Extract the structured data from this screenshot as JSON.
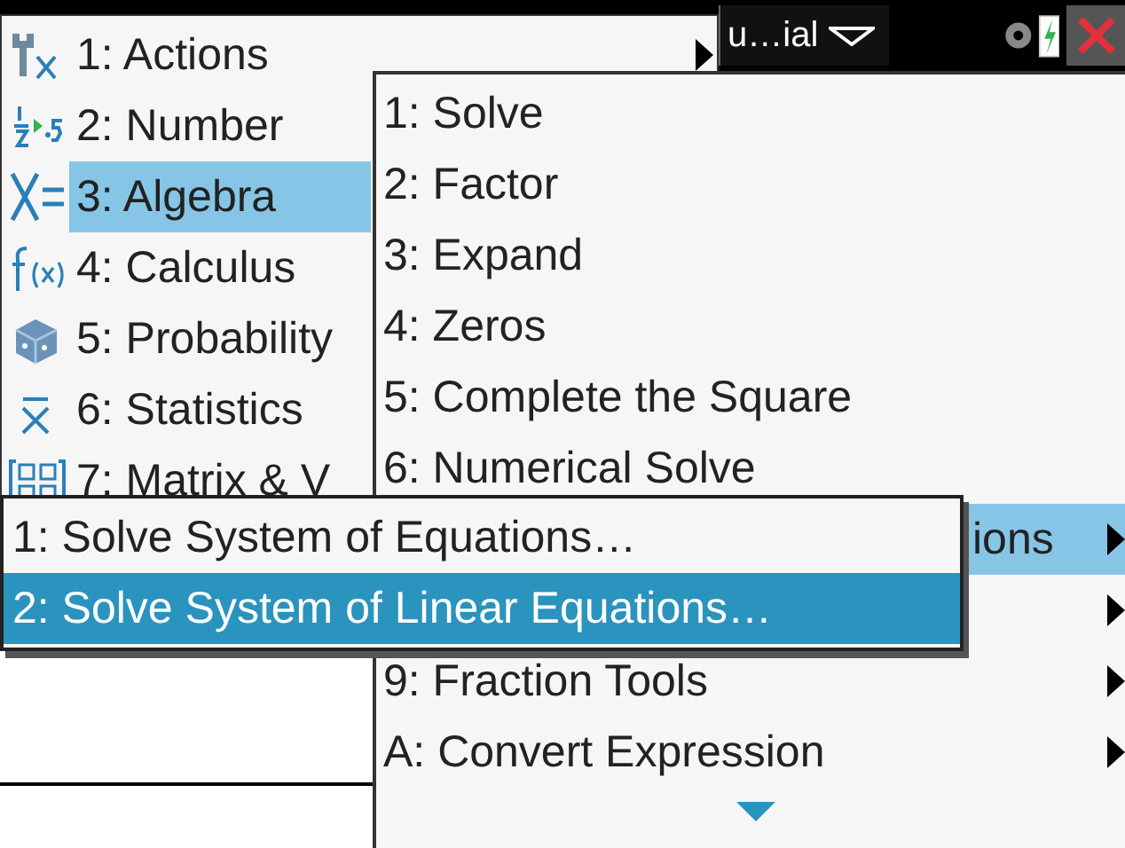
{
  "top_bar": {
    "tab_label": "u…ial"
  },
  "menu": {
    "items": [
      {
        "label": "1: Actions",
        "has_submenu": true,
        "selected": false
      },
      {
        "label": "2: Number",
        "selected": false
      },
      {
        "label": "3: Algebra",
        "selected": true
      },
      {
        "label": "4: Calculus",
        "selected": false
      },
      {
        "label": "5: Probability",
        "selected": false
      },
      {
        "label": "6: Statistics",
        "selected": false
      },
      {
        "label": "7: Matrix & V",
        "selected": false
      }
    ]
  },
  "submenu": {
    "more_below": true,
    "items": [
      {
        "label": "1: Solve",
        "has_submenu": false,
        "selected": false
      },
      {
        "label": "2: Factor",
        "has_submenu": false,
        "selected": false
      },
      {
        "label": "3: Expand",
        "has_submenu": false,
        "selected": false
      },
      {
        "label": "4: Zeros",
        "has_submenu": false,
        "selected": false
      },
      {
        "label": "5: Complete the Square",
        "has_submenu": false,
        "selected": false
      },
      {
        "label": "6: Numerical Solve",
        "has_submenu": false,
        "selected": false
      },
      {
        "label": "ions",
        "clipped_left": true,
        "has_submenu": true,
        "selected": true
      },
      {
        "has_submenu": true,
        "selected": false
      },
      {
        "label": "9: Fraction Tools",
        "has_submenu": true,
        "selected": false
      },
      {
        "label": "A: Convert Expression",
        "has_submenu": true,
        "selected": false
      }
    ]
  },
  "subsubmenu": {
    "items": [
      {
        "label": "1: Solve System of Equations…",
        "selected": false
      },
      {
        "label": "2: Solve System of Linear Equations…",
        "selected": true
      }
    ]
  }
}
